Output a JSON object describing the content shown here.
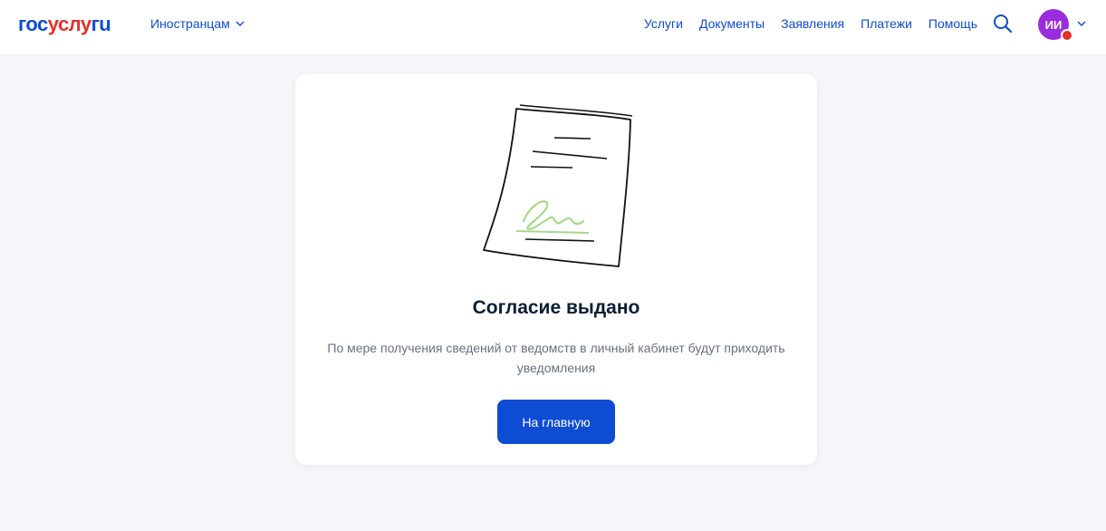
{
  "header": {
    "logo": {
      "part1": "гос",
      "part2": "услу",
      "part3": "гu"
    },
    "region_label": "Иностранцам",
    "nav": [
      "Услуги",
      "Документы",
      "Заявления",
      "Платежи",
      "Помощь"
    ],
    "avatar_initials": "ИИ"
  },
  "card": {
    "title": "Согласие выдано",
    "description": "По мере получения сведений от ведомств в личный кабинет будут приходить уведомления",
    "button_label": "На главную"
  },
  "colors": {
    "primary": "#0d4cd3",
    "accent_red": "#e4312c",
    "avatar": "#9b2bde",
    "background": "#f5f7fa",
    "signature": "#a8d88a"
  }
}
